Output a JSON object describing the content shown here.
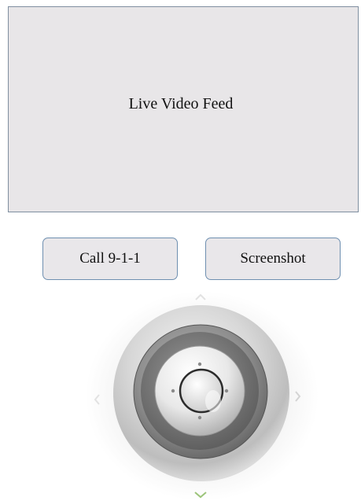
{
  "video": {
    "label": "Live Video Feed"
  },
  "buttons": {
    "call_label": "Call 9-1-1",
    "screenshot_label": "Screenshot"
  },
  "joystick": {
    "directions": [
      "up-arrow-icon",
      "down-arrow-icon",
      "left-arrow-icon",
      "right-arrow-icon"
    ],
    "down_arrow_color": "#9cc47a"
  }
}
